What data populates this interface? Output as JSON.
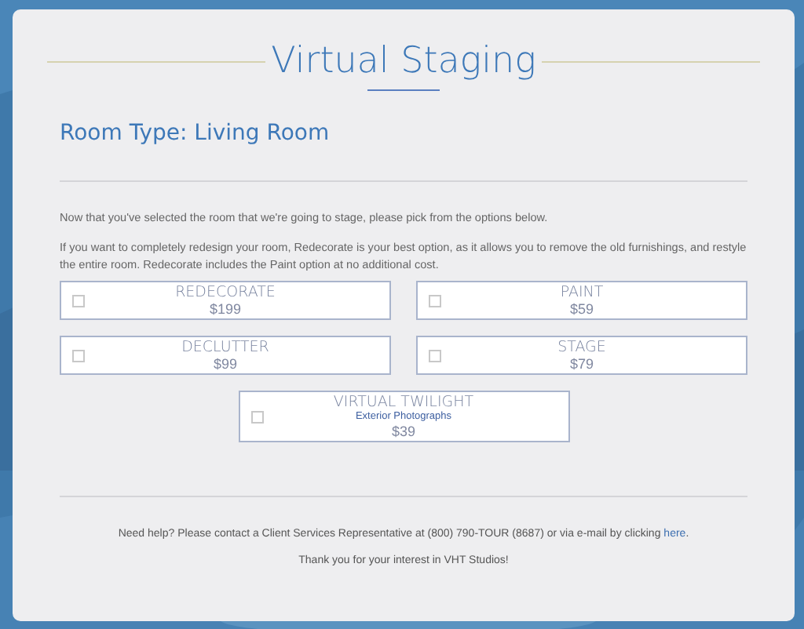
{
  "title": "Virtual Staging",
  "room_type": "Room Type: Living Room",
  "intro": [
    "Now that you've selected the room that we're going to stage, please pick from the options below.",
    "If you want to completely redesign your room, Redecorate is your best option, as it allows you to remove the old furnishings, and restyle the entire room. Redecorate includes the Paint option at no additional cost."
  ],
  "options": [
    {
      "name": "REDECORATE",
      "price": "$199",
      "checked": false
    },
    {
      "name": "PAINT",
      "price": "$59",
      "checked": false
    },
    {
      "name": "DECLUTTER",
      "price": "$99",
      "checked": false
    },
    {
      "name": "STAGE",
      "price": "$79",
      "checked": false
    },
    {
      "name": "VIRTUAL TWILIGHT",
      "subtitle": "Exterior Photographs",
      "price": "$39",
      "checked": false
    }
  ],
  "help": {
    "text": "Need help? Please contact a Client Services Representative at (800) 790-TOUR (8687) or via e-mail by clicking ",
    "link": "here",
    "end": "."
  },
  "thanks": "Thank you for your interest in VHT Studios!"
}
